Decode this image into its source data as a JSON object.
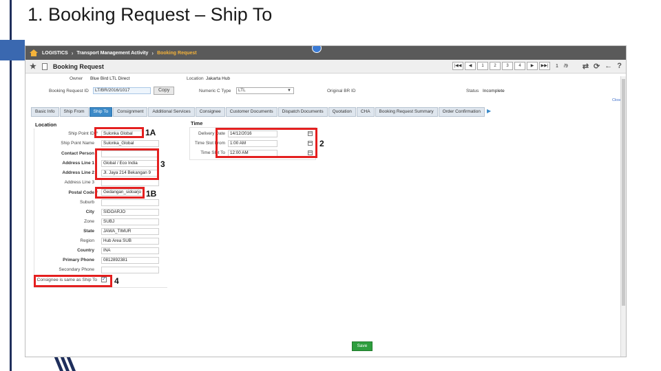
{
  "slide": {
    "title": "1. Booking Request – Ship To"
  },
  "navbar": {
    "items": [
      "LOGISTICS",
      "Transport Management Activity",
      "Booking Request"
    ]
  },
  "toolbar": {
    "title": "Booking Request",
    "pager": {
      "first": "|◀◀",
      "prev": "◀",
      "p1": "1",
      "p2": "2",
      "p3": "3",
      "p4": "4",
      "next": "▶",
      "last": "▶▶|",
      "current": "1",
      "of": "/9"
    }
  },
  "header": {
    "owner_label": "Owner",
    "owner_value": "Blue Bird LTL Direct",
    "location_label": "Location",
    "location_value": "Jakarta Hub",
    "br_id_label": "Booking Request ID",
    "br_id_value": "LT/BR/2016/1017",
    "copy_label": "Copy",
    "num_type_label": "Numeric C Type",
    "num_type_value": "LTL",
    "orig_br_label": "Original BR ID",
    "status_label": "Status",
    "status_value": "Incomplete"
  },
  "close_link": "Close",
  "tabs": [
    "Basic Info",
    "Ship From",
    "Ship To",
    "Consignment",
    "Additional Services",
    "Consignee",
    "Customer Documents",
    "Dispatch Documents",
    "Quotation",
    "CHA",
    "Booking Request Summary",
    "Order Confirmation"
  ],
  "tab_arrow": "▶",
  "location": {
    "title": "Location",
    "fields": [
      {
        "label": "Ship Point ID",
        "value": "Sulonka Global"
      },
      {
        "label": "Ship Point Name",
        "value": "Sulonka_Global"
      },
      {
        "label": "Contact Person",
        "value": ""
      },
      {
        "label": "Address Line 1",
        "value": "Global / Eco India"
      },
      {
        "label": "Address Line 2",
        "value": "Jl. Jaya 214 Bekangan 9"
      },
      {
        "label": "Address Line 3",
        "value": ""
      },
      {
        "label": "Postal Code",
        "value": "Gedangan_sidoarjo"
      },
      {
        "label": "Suburb",
        "value": ""
      },
      {
        "label": "City",
        "value": "SIDOARJO"
      },
      {
        "label": "Zone",
        "value": "SUBJ"
      },
      {
        "label": "State",
        "value": "JAWA_TIMUR"
      },
      {
        "label": "Region",
        "value": "Hub Area SUB"
      },
      {
        "label": "Country",
        "value": "INA"
      },
      {
        "label": "Primary Phone",
        "value": "0812892381"
      },
      {
        "label": "Secondary Phone",
        "value": ""
      }
    ],
    "consignee_same_label": "Consignee is same as Ship To",
    "consignee_same_checked": "✓"
  },
  "time": {
    "title": "Time",
    "fields": [
      {
        "label": "Delivery Date",
        "value": "14/12/2016"
      },
      {
        "label": "Time Slot From",
        "value": "1:00 AM"
      },
      {
        "label": "Time Slot To",
        "value": "12:00 AM"
      }
    ]
  },
  "save_label": "Save",
  "annotations": {
    "a1": "1A",
    "a2": "2",
    "a3": "3",
    "a4": "1B",
    "a5": "4"
  },
  "colors": {
    "annotation": "#e41f1f",
    "active_tab": "#3c8ac8",
    "save": "#2e9e3e",
    "navbar": "#5a5a5a"
  },
  "icons": {
    "home": "home-icon",
    "star": "star-icon",
    "document": "document-icon",
    "search": "search-icon",
    "calendar": "calendar-icon"
  }
}
